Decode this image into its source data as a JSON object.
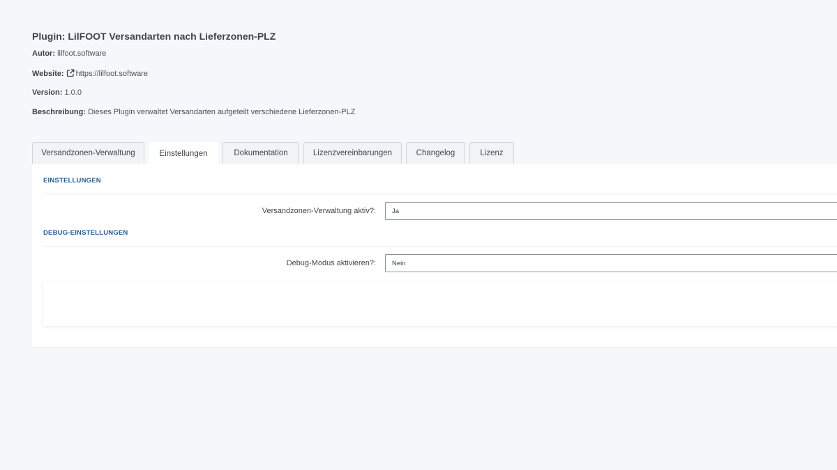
{
  "header": {
    "title": "Plugin: LilFOOT Versandarten nach Lieferzonen-PLZ",
    "author_label": "Autor:",
    "author_value": "lilfoot.software",
    "website_label": "Website:",
    "website_value": "https://lilfoot.software",
    "website_icon": "external-link-icon",
    "version_label": "Version:",
    "version_value": "1.0.0",
    "description_label": "Beschreibung:",
    "description_value": "Dieses Plugin verwaltet Versandarten aufgeteilt verschiedene Lieferzonen-PLZ"
  },
  "tabs": [
    {
      "label": "Versandzonen-Verwaltung",
      "active": false
    },
    {
      "label": "Einstellungen",
      "active": true
    },
    {
      "label": "Dokumentation",
      "active": false
    },
    {
      "label": "Lizenzvereinbarungen",
      "active": false
    },
    {
      "label": "Changelog",
      "active": false
    },
    {
      "label": "Lizenz",
      "active": false
    }
  ],
  "settings": {
    "section_heading": "EINSTELLUNGEN",
    "field_label": "Versandzonen-Verwaltung aktiv?:",
    "field_value": "Ja"
  },
  "debug": {
    "section_heading": "DEBUG-EINSTELLUNGEN",
    "field_label": "Debug-Modus aktivieren?:",
    "field_value": "Nein"
  },
  "colors": {
    "background": "#f5f7fa",
    "section_heading": "#1f5f9a",
    "panel": "#ffffff"
  }
}
